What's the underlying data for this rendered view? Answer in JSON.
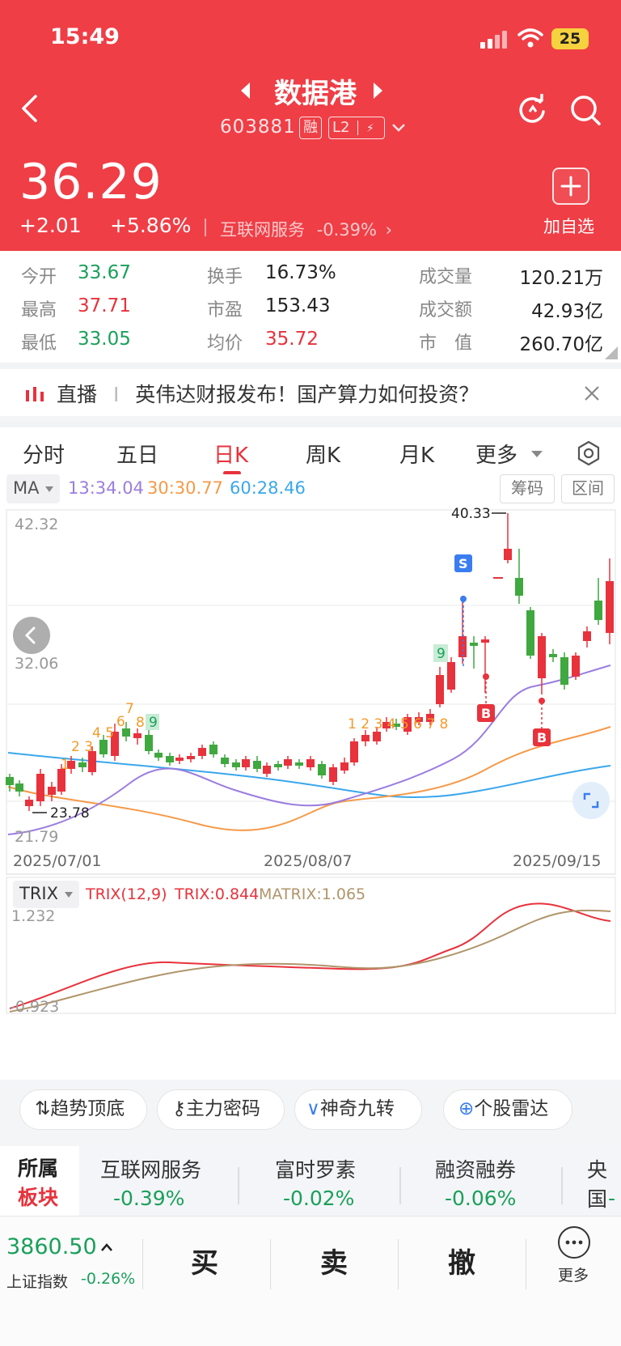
{
  "status_bar": {
    "time": "15:49",
    "battery": "25"
  },
  "header": {
    "stock_name": "数据港",
    "stock_code": "603881",
    "tags": [
      "融",
      "L2",
      "⚡"
    ],
    "price": "36.29",
    "change": "+2.01",
    "change_pct": "+5.86%",
    "sector": "互联网服务",
    "sector_change": "-0.39%",
    "add_watch": "加自选"
  },
  "stats": [
    {
      "label": "今开",
      "value": "33.67",
      "color": "#1aa05a"
    },
    {
      "label": "最高",
      "value": "37.71",
      "color": "#e8323c"
    },
    {
      "label": "最低",
      "value": "33.05",
      "color": "#1aa05a"
    },
    {
      "label": "换手",
      "value": "16.73%",
      "color": "#222222"
    },
    {
      "label": "市盈",
      "value": "153.43",
      "color": "#222222"
    },
    {
      "label": "均价",
      "value": "35.72",
      "color": "#e8323c"
    },
    {
      "label": "成交量",
      "value": "120.21万",
      "color": "#222222"
    },
    {
      "label": "成交额",
      "value": "42.93亿",
      "color": "#222222"
    },
    {
      "label": "市　值",
      "value": "260.70亿",
      "color": "#222222"
    }
  ],
  "live": {
    "tag": "直播",
    "text": "英伟达财报发布！国产算力如何投资？"
  },
  "tabs": [
    "分时",
    "五日",
    "日K",
    "周K",
    "月K",
    "更多"
  ],
  "active_tab": "日K",
  "ma_bar": {
    "label": "MA",
    "ma13": "13:34.04",
    "ma30": "30:30.77",
    "ma60": "60:28.46",
    "btn1": "筹码",
    "btn2": "区间"
  },
  "kline": {
    "y_top": "42.32",
    "y_mid": "32.06",
    "y_bottom": "21.79",
    "high_label": "40.33",
    "low_label": "23.78",
    "dates": [
      "2025/07/01",
      "2025/08/07",
      "2025/09/15"
    ],
    "signals": {
      "sell": "S",
      "buy": "B"
    }
  },
  "trix_bar": {
    "label": "TRIX",
    "params": "TRIX(12,9)",
    "trix": "TRIX:0.844",
    "matrix": "MATRIX:1.065",
    "y_top": "1.232",
    "y_bottom": "-0.923"
  },
  "tools": [
    "趋势顶底",
    "主力密码",
    "神奇九转",
    "个股雷达"
  ],
  "sector_strip": {
    "title1": "所属",
    "title2": "板块",
    "items": [
      {
        "name": "互联网服务",
        "value": "-0.39%"
      },
      {
        "name": "富时罗素",
        "value": "-0.02%"
      },
      {
        "name": "融资融券",
        "value": "-0.06%"
      },
      {
        "name": "央国",
        "value": "-"
      }
    ]
  },
  "bottom_bar": {
    "index_value": "3860.50",
    "index_name": "上证指数",
    "index_change": "-0.26%",
    "buy": "买",
    "sell": "卖",
    "cancel": "撤",
    "more": "更多"
  },
  "chart_data": {
    "type": "candlestick",
    "x_range": [
      "2025/07/01",
      "2025/09/15"
    ],
    "ylim": [
      21.79,
      42.32
    ],
    "max_high": 40.33,
    "min_low": 23.78,
    "moving_averages": [
      {
        "name": "MA13",
        "last": 34.04
      },
      {
        "name": "MA30",
        "last": 30.77
      },
      {
        "name": "MA60",
        "last": 28.46
      }
    ],
    "indicator": {
      "name": "TRIX(12,9)",
      "trix": 0.844,
      "matrix": 1.065,
      "ylim": [
        -0.923,
        1.232
      ]
    }
  }
}
